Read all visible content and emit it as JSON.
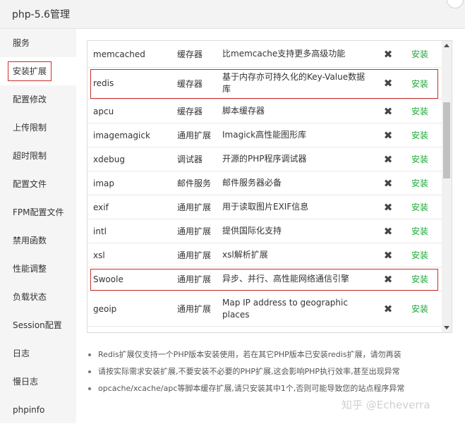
{
  "window": {
    "title": "php-5.6管理"
  },
  "sidebar": {
    "items": [
      {
        "label": "服务"
      },
      {
        "label": "安装扩展",
        "active": true
      },
      {
        "label": "配置修改"
      },
      {
        "label": "上传限制"
      },
      {
        "label": "超时限制"
      },
      {
        "label": "配置文件"
      },
      {
        "label": "FPM配置文件"
      },
      {
        "label": "禁用函数"
      },
      {
        "label": "性能调整"
      },
      {
        "label": "负载状态"
      },
      {
        "label": "Session配置"
      },
      {
        "label": "日志"
      },
      {
        "label": "慢日志"
      },
      {
        "label": "phpinfo"
      }
    ]
  },
  "extensions": [
    {
      "name": "memcached",
      "type": "缓存器",
      "desc": "比memcache支持更多高级功能",
      "status": "✖",
      "action": "安装"
    },
    {
      "name": "redis",
      "type": "缓存器",
      "desc": "基于内存亦可持久化的Key-Value数据库",
      "status": "✖",
      "action": "安装",
      "highlight": true
    },
    {
      "name": "apcu",
      "type": "缓存器",
      "desc": "脚本缓存器",
      "status": "✖",
      "action": "安装"
    },
    {
      "name": "imagemagick",
      "type": "通用扩展",
      "desc": "Imagick高性能图形库",
      "status": "✖",
      "action": "安装"
    },
    {
      "name": "xdebug",
      "type": "调试器",
      "desc": "开源的PHP程序调试器",
      "status": "✖",
      "action": "安装"
    },
    {
      "name": "imap",
      "type": "邮件服务",
      "desc": "邮件服务器必备",
      "status": "✖",
      "action": "安装"
    },
    {
      "name": "exif",
      "type": "通用扩展",
      "desc": "用于读取图片EXIF信息",
      "status": "✖",
      "action": "安装"
    },
    {
      "name": "intl",
      "type": "通用扩展",
      "desc": "提供国际化支持",
      "status": "✖",
      "action": "安装"
    },
    {
      "name": "xsl",
      "type": "通用扩展",
      "desc": "xsl解析扩展",
      "status": "✖",
      "action": "安装"
    },
    {
      "name": "Swoole",
      "type": "通用扩展",
      "desc": "异步、并行、高性能网络通信引擎",
      "status": "✖",
      "action": "安装",
      "highlight": true
    },
    {
      "name": "geoip",
      "type": "通用扩展",
      "desc": "Map IP address to geographic places",
      "status": "✖",
      "action": "安装"
    }
  ],
  "notes": [
    "Redis扩展仅支持一个PHP版本安装使用，若在其它PHP版本已安装redis扩展，请勿再装",
    "请按实际需求安装扩展,不要安装不必要的PHP扩展,这会影响PHP执行效率,甚至出现异常",
    "opcache/xcache/apc等脚本缓存扩展,请只安装其中1个,否则可能导致您的站点程序异常"
  ],
  "watermark": "知乎 @Echeverra",
  "colors": {
    "install": "#20a53a",
    "highlight_border": "#c9302c"
  }
}
